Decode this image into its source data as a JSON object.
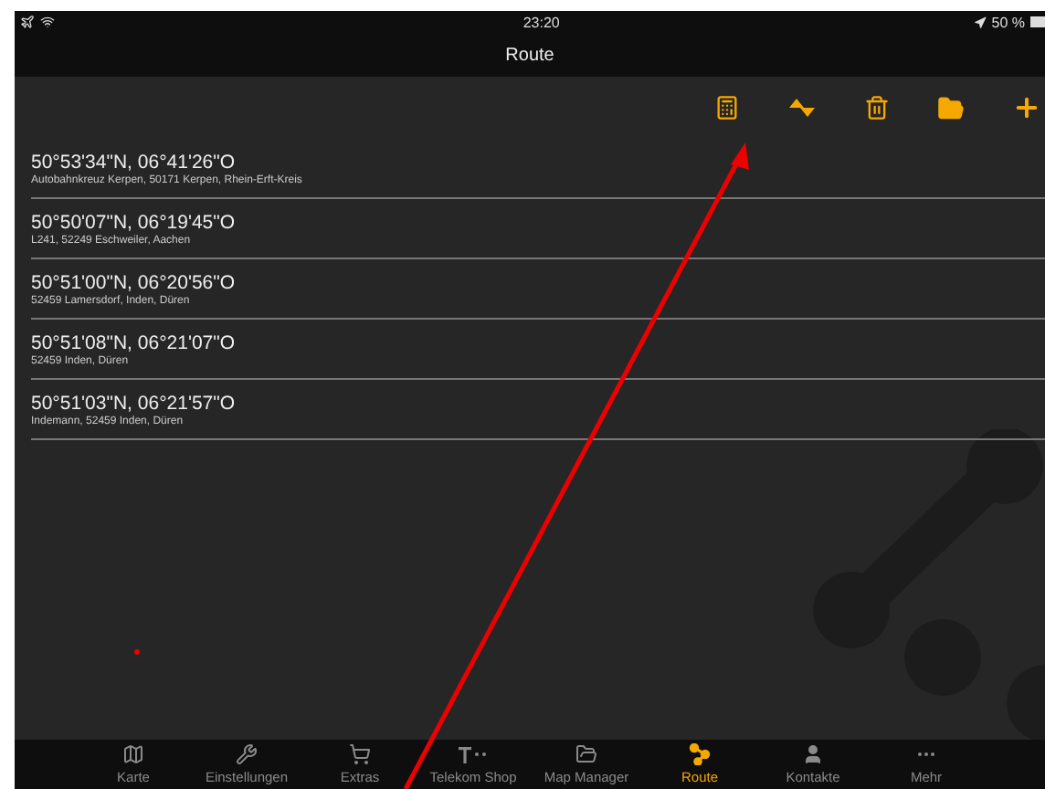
{
  "status_bar": {
    "time": "23:20",
    "battery": "50 %"
  },
  "nav_bar": {
    "title": "Route"
  },
  "route_points": [
    {
      "coordinates": "50°53'34\"N, 06°41'26\"O",
      "address": "Autobahnkreuz Kerpen, 50171 Kerpen, Rhein-Erft-Kreis"
    },
    {
      "coordinates": "50°50'07\"N, 06°19'45\"O",
      "address": "L241, 52249 Eschweiler, Aachen"
    },
    {
      "coordinates": "50°51'00\"N, 06°20'56\"O",
      "address": "52459 Lamersdorf, Inden, Düren"
    },
    {
      "coordinates": "50°51'08\"N, 06°21'07\"O",
      "address": "52459 Inden, Düren"
    },
    {
      "coordinates": "50°51'03\"N, 06°21'57\"O",
      "address": "Indemann, 52459 Inden, Düren"
    }
  ],
  "tab_bar": [
    {
      "kind": "map",
      "label": "Karte",
      "selected": false
    },
    {
      "kind": "tools",
      "label": "Einstellungen",
      "selected": false
    },
    {
      "kind": "cart",
      "label": "Extras",
      "selected": false
    },
    {
      "kind": "telekom",
      "label": "Telekom Shop",
      "selected": false
    },
    {
      "kind": "manager",
      "label": "Map Manager",
      "selected": false
    },
    {
      "kind": "route",
      "label": "Route",
      "selected": true
    },
    {
      "kind": "person",
      "label": "Kontakte",
      "selected": false
    },
    {
      "kind": "more",
      "label": "Mehr",
      "selected": false
    }
  ]
}
